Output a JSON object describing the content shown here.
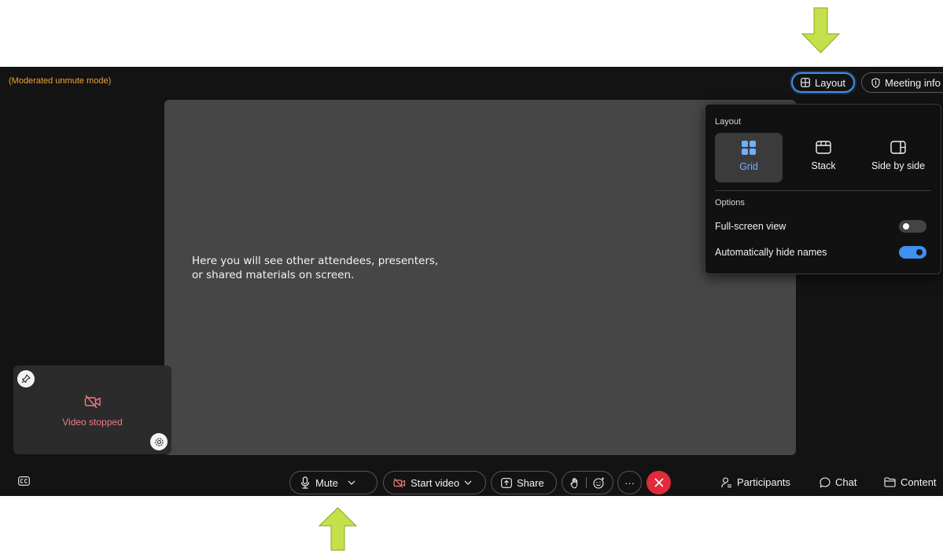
{
  "header": {
    "mode_label": "(Moderated unmute mode)",
    "layout_button": "Layout",
    "meeting_info_button": "Meeting info"
  },
  "stage": {
    "message_line1": "Here you will see other attendees, presenters,",
    "message_line2": "or shared materials on screen."
  },
  "self_view": {
    "status": "Video stopped"
  },
  "layout_popup": {
    "layout_heading": "Layout",
    "options": [
      {
        "label": "Grid",
        "selected": true
      },
      {
        "label": "Stack",
        "selected": false
      },
      {
        "label": "Side by side",
        "selected": false
      }
    ],
    "options_heading": "Options",
    "full_screen_view": {
      "label": "Full-screen view",
      "enabled": false
    },
    "auto_hide_names": {
      "label": "Automatically hide names",
      "enabled": true
    }
  },
  "controls": {
    "mute": "Mute",
    "start_video": "Start video",
    "share": "Share",
    "more": "···"
  },
  "side_panel_buttons": {
    "participants": "Participants",
    "chat": "Chat",
    "content": "Content"
  },
  "colors": {
    "accent": "#3f90f0",
    "moderated_label": "#f0a43a",
    "leave": "#e02b3a",
    "video_stopped": "#f07a85",
    "annotation_arrow": "#c4e04a"
  },
  "icons": {
    "layout": "grid-icon",
    "meeting_info": "shield-icon",
    "mute": "microphone-icon",
    "start_video": "video-off-icon",
    "share": "share-screen-icon",
    "raise_hand": "hand-icon",
    "reactions": "emoji-icon",
    "leave": "close-icon",
    "participants": "participants-icon",
    "chat": "chat-icon",
    "content": "folder-icon",
    "captions": "closed-captions-icon"
  }
}
